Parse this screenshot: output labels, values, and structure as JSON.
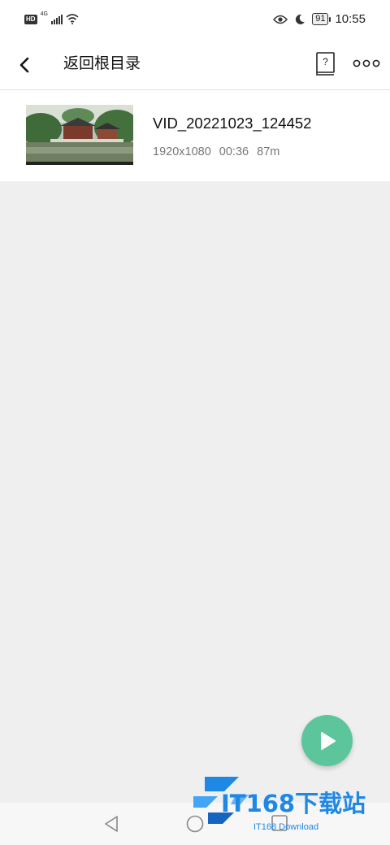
{
  "status_bar": {
    "hd": "HD",
    "network": "4G",
    "battery": "91",
    "time": "10:55"
  },
  "header": {
    "title": "返回根目录",
    "help_glyph": "?"
  },
  "files": [
    {
      "name": "VID_20221023_124452",
      "resolution": "1920x1080",
      "duration": "00:36",
      "size": "87m"
    }
  ],
  "fab": {
    "icon": "play-icon",
    "color": "#5cc59b"
  },
  "watermark": {
    "text": "IT168下载站",
    "subtext": "IT168 Download"
  }
}
